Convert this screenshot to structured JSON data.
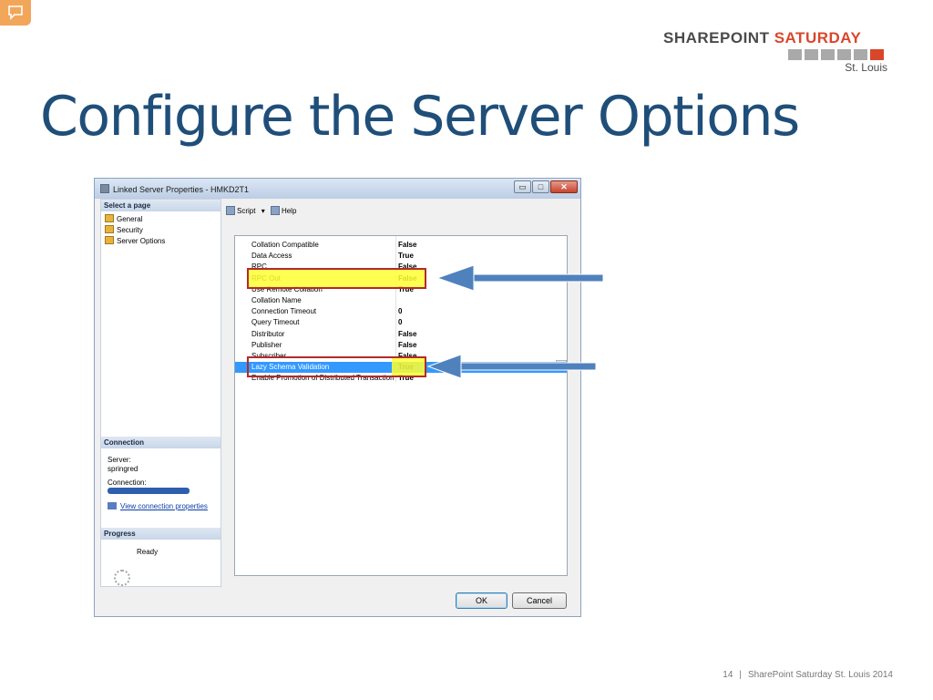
{
  "slide": {
    "title": "Configure the Server Options",
    "logo": {
      "sharepoint": "SHAREPOINT",
      "saturday": "SATURDAY",
      "city": "St. Louis"
    },
    "footer": {
      "page_number": "14",
      "separator": "|",
      "text": "SharePoint Saturday St. Louis 2014"
    }
  },
  "dialog": {
    "title": "Linked Server Properties - HMKD2T1",
    "window_controls": {
      "minimize": "▭",
      "maximize": "□",
      "close": "✕"
    },
    "select_page": {
      "header": "Select a page",
      "items": [
        {
          "label": "General"
        },
        {
          "label": "Security"
        },
        {
          "label": "Server Options"
        }
      ]
    },
    "connection": {
      "header": "Connection",
      "server_label": "Server:",
      "server_value": "springred",
      "connection_label": "Connection:",
      "link": "View connection properties"
    },
    "progress": {
      "header": "Progress",
      "status": "Ready"
    },
    "toolbar": {
      "script": "Script",
      "dropdown": "▾",
      "help": "Help"
    },
    "properties": [
      {
        "name": "Collation Compatible",
        "value": "False"
      },
      {
        "name": "Data Access",
        "value": "True"
      },
      {
        "name": "RPC",
        "value": "False"
      },
      {
        "name": "RPC Out",
        "value": "False"
      },
      {
        "name": "Use Remote Collation",
        "value": "True"
      },
      {
        "name": "Collation Name",
        "value": ""
      },
      {
        "name": "Connection Timeout",
        "value": "0"
      },
      {
        "name": "Query Timeout",
        "value": "0"
      },
      {
        "name": "Distributor",
        "value": "False"
      },
      {
        "name": "Publisher",
        "value": "False"
      },
      {
        "name": "Subscriber",
        "value": "False"
      },
      {
        "name": "Lazy Schema Validation",
        "value": "True"
      },
      {
        "name": "Enable Promotion of Distributed Transactions",
        "value": "True"
      }
    ],
    "buttons": {
      "ok": "OK",
      "cancel": "Cancel"
    }
  },
  "colors": {
    "title": "#1f4e79",
    "logo_accent": "#d9472b",
    "annotation_arrow": "#4f81bd",
    "annotation_box": "#b22a2a",
    "highlight": "#ffff33",
    "selection": "#3399ff"
  },
  "icons": {
    "comment": "speech-bubble-icon",
    "page_item": "wrench-page-icon",
    "script": "script-icon",
    "help": "help-icon",
    "connection_link": "connection-icon",
    "progress": "spinner-icon"
  }
}
